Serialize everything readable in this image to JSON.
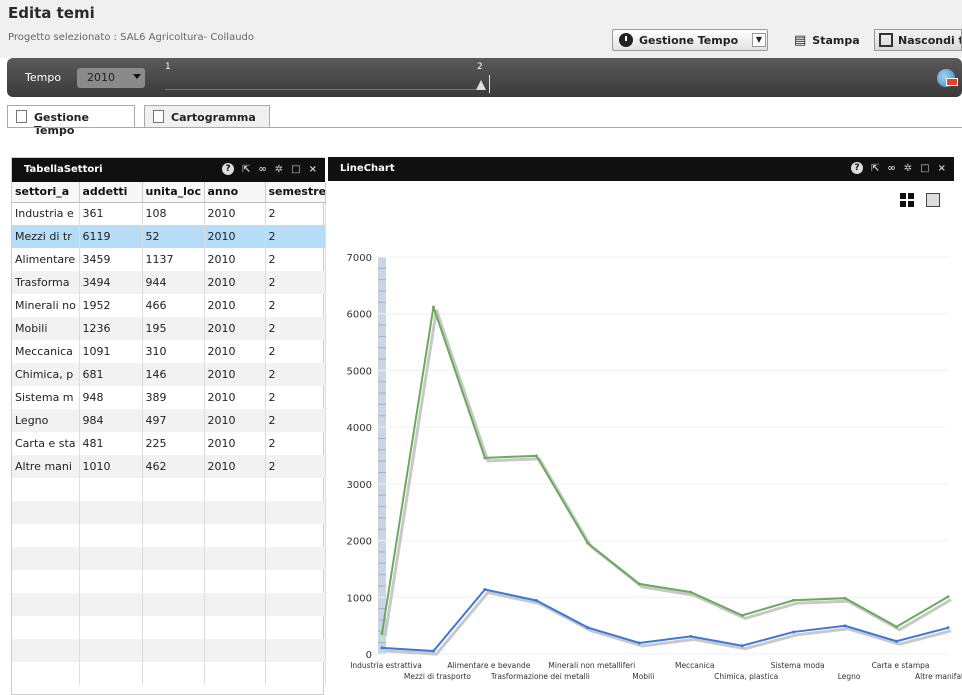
{
  "header": {
    "title": "Edita temi",
    "subtitle": "Progetto selezionato : SAL6 Agricoltura- Collaudo",
    "gestione_tempo_label": "Gestione Tempo",
    "stampa_label": "Stampa",
    "nascondi_label": "Nascondi t"
  },
  "time_bar": {
    "tempo_label": "Tempo",
    "year_value": "2010",
    "slider_label_1": "1",
    "slider_label_2": "2"
  },
  "tabs": [
    {
      "label": "Gestione Tempo",
      "active": true
    },
    {
      "label": "Cartogramma",
      "active": false
    }
  ],
  "left_panel": {
    "title": "TabellaSettori",
    "columns": [
      "settori_a",
      "addetti",
      "unita_loc",
      "anno",
      "semestre"
    ],
    "rows": [
      [
        "Industria e",
        "361",
        "108",
        "2010",
        "2"
      ],
      [
        "Mezzi di tr",
        "6119",
        "52",
        "2010",
        "2"
      ],
      [
        "Alimentare",
        "3459",
        "1137",
        "2010",
        "2"
      ],
      [
        "Trasforma",
        "3494",
        "944",
        "2010",
        "2"
      ],
      [
        "Minerali no",
        "1952",
        "466",
        "2010",
        "2"
      ],
      [
        "Mobili",
        "1236",
        "195",
        "2010",
        "2"
      ],
      [
        "Meccanica",
        "1091",
        "310",
        "2010",
        "2"
      ],
      [
        "Chimica, p",
        "681",
        "146",
        "2010",
        "2"
      ],
      [
        "Sistema m",
        "948",
        "389",
        "2010",
        "2"
      ],
      [
        "Legno",
        "984",
        "497",
        "2010",
        "2"
      ],
      [
        "Carta e sta",
        "481",
        "225",
        "2010",
        "2"
      ],
      [
        "Altre mani",
        "1010",
        "462",
        "2010",
        "2"
      ]
    ],
    "selected_row": 1,
    "empty_rows": 9
  },
  "right_panel": {
    "title": "LineChart"
  },
  "chart_data": {
    "type": "line",
    "categories": [
      "Industria estrattiva",
      "Mezzi di trasporto",
      "Alimentare e bevande",
      "Trasformazione dei metalli",
      "Minerali non metalliferi",
      "Mobili",
      "Meccanica",
      "Chimica, plastica",
      "Sistema moda",
      "Legno",
      "Carta e stampa",
      "Altre manifatturiere"
    ],
    "series": [
      {
        "values": [
          361,
          6119,
          3459,
          3494,
          1952,
          1236,
          1091,
          681,
          948,
          984,
          481,
          1010
        ],
        "color": "#6aaa5c"
      },
      {
        "values": [
          108,
          52,
          1137,
          944,
          466,
          195,
          310,
          146,
          389,
          497,
          225,
          462
        ],
        "color": "#3b78d8"
      }
    ],
    "ylim": [
      0,
      7000
    ],
    "yticks": [
      0,
      1000,
      2000,
      3000,
      4000,
      5000,
      6000,
      7000
    ],
    "grid": true,
    "legend": "none"
  },
  "colors": {
    "selected_row": "#b7dcf7",
    "panel_header": "#101010",
    "toolbar": "#4a4a4a"
  }
}
